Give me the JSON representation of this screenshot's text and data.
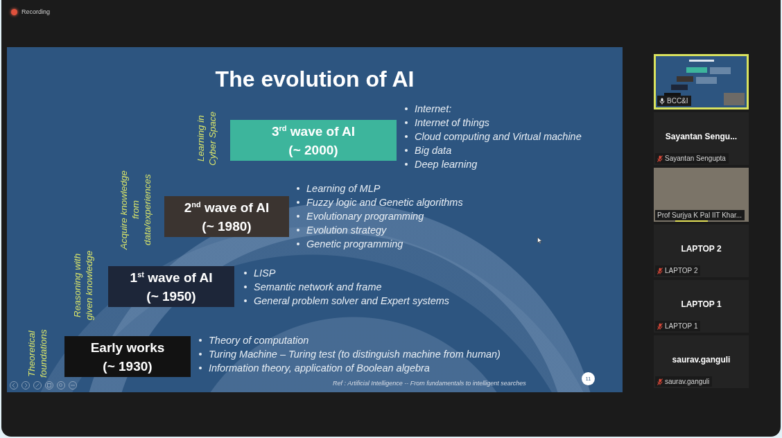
{
  "recording": {
    "label": "Recording"
  },
  "slide": {
    "title": "The evolution of AI",
    "waves": [
      {
        "title": "3$^{rd}$ wave of AI",
        "year": "(~ 2000)",
        "color": "#3db59c",
        "side_label": [
          "Learning in",
          "Cyber Space"
        ],
        "bullets": [
          "Internet:",
          "Internet of things",
          "Cloud computing and Virtual machine",
          "Big data",
          "Deep learning"
        ]
      },
      {
        "title": "2$^{nd}$ wave of AI",
        "year": "(~ 1980)",
        "color": "#3b3430",
        "side_label": [
          "Acquire knowledge",
          "from",
          "data/experiences"
        ],
        "bullets": [
          "Learning of MLP",
          "Fuzzy logic and Genetic algorithms",
          "Evolutionary programming",
          "Evolution strategy",
          "Genetic programming"
        ]
      },
      {
        "title": "1$^{st}$ wave of AI",
        "year": "(~ 1950)",
        "color": "#1d2639",
        "side_label": [
          "Reasoning with",
          "given knowledge"
        ],
        "bullets": [
          "LISP",
          "Semantic network and frame",
          "General problem solver and Expert systems"
        ]
      },
      {
        "title": "Early works",
        "year": "(~ 1930)",
        "color": "#121212",
        "side_label": [
          "Theoretical",
          "foundations"
        ],
        "bullets": [
          "Theory of computation",
          "Turing Machine – Turing test (to distinguish machine from human)",
          "Information theory, application of Boolean algebra"
        ]
      }
    ],
    "reference": "Ref : Artificial Intelligence -- From fundamentals to intelligent searches",
    "page_number": "11"
  },
  "participants": [
    {
      "kind": "screen",
      "label": "BCC&I",
      "selected": true,
      "speaking": false,
      "muted": false
    },
    {
      "kind": "name",
      "name": "Sayantan  Sengu...",
      "label": "Sayantan Sengupta",
      "selected": false,
      "speaking": false,
      "muted": true
    },
    {
      "kind": "video",
      "label": "Prof Surjya K Pal IIT Khar...",
      "selected": false,
      "speaking": true,
      "muted": false
    },
    {
      "kind": "name",
      "name": "LAPTOP 2",
      "label": "LAPTOP 2",
      "selected": false,
      "speaking": false,
      "muted": true
    },
    {
      "kind": "name",
      "name": "LAPTOP 1",
      "label": "LAPTOP 1",
      "selected": false,
      "speaking": false,
      "muted": true
    },
    {
      "kind": "name",
      "name": "saurav.ganguli",
      "label": "saurav.ganguli",
      "selected": false,
      "speaking": false,
      "muted": true
    }
  ]
}
